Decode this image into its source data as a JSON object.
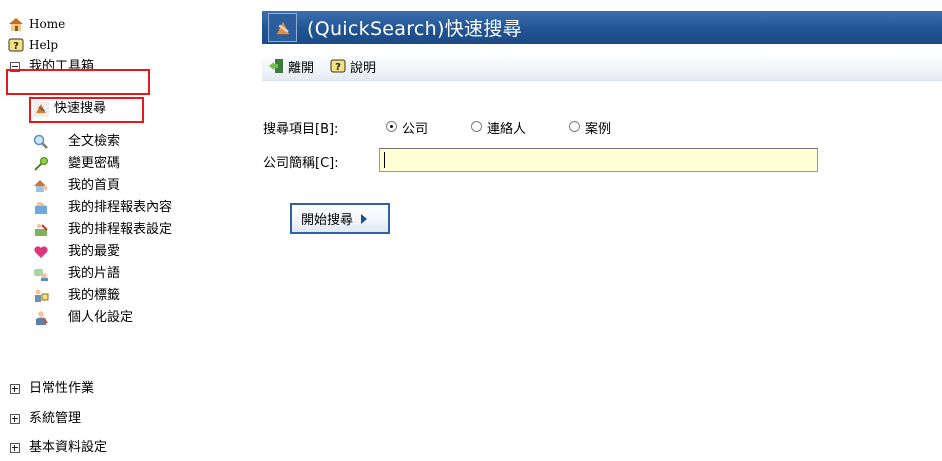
{
  "sidebar": {
    "items": [
      {
        "label": "Home",
        "icon": "home-icon"
      },
      {
        "label": "Help",
        "icon": "help-icon"
      },
      {
        "label": "我的工具箱",
        "icon": "collapse-icon",
        "expanded": true
      },
      {
        "label": "快速搜尋",
        "icon": "quicksearch-icon",
        "selected": true
      },
      {
        "label": "全文檢索",
        "icon": "magnifier-icon"
      },
      {
        "label": "變更密碼",
        "icon": "key-icon"
      },
      {
        "label": "我的首頁",
        "icon": "house-person-icon"
      },
      {
        "label": "我的排程報表內容",
        "icon": "report-content-icon"
      },
      {
        "label": "我的排程報表設定",
        "icon": "report-settings-icon"
      },
      {
        "label": "我的最愛",
        "icon": "heart-icon"
      },
      {
        "label": "我的片語",
        "icon": "phrases-icon"
      },
      {
        "label": "我的標籤",
        "icon": "tag-icon"
      },
      {
        "label": "個人化設定",
        "icon": "personalize-icon"
      },
      {
        "label": "日常性作業",
        "icon": "expand-icon",
        "expanded": false
      },
      {
        "label": "系統管理",
        "icon": "expand-icon",
        "expanded": false
      },
      {
        "label": "基本資料設定",
        "icon": "expand-icon",
        "expanded": false
      }
    ]
  },
  "header": {
    "title": "(QuickSearch)快速搜尋",
    "icon": "quicksearch-icon"
  },
  "toolbar": {
    "leave_label": "離開",
    "help_label": "說明"
  },
  "form": {
    "search_item_label": "搜尋項目[B]:",
    "options": [
      {
        "label": "公司",
        "checked": true
      },
      {
        "label": "連絡人",
        "checked": false
      },
      {
        "label": "案例",
        "checked": false
      }
    ],
    "company_label": "公司簡稱[C]:",
    "company_value": "",
    "start_label": "開始搜尋"
  },
  "colors": {
    "titlebar": "#225493",
    "highlight": "#e8191c",
    "input_bg": "#ffffd6"
  }
}
